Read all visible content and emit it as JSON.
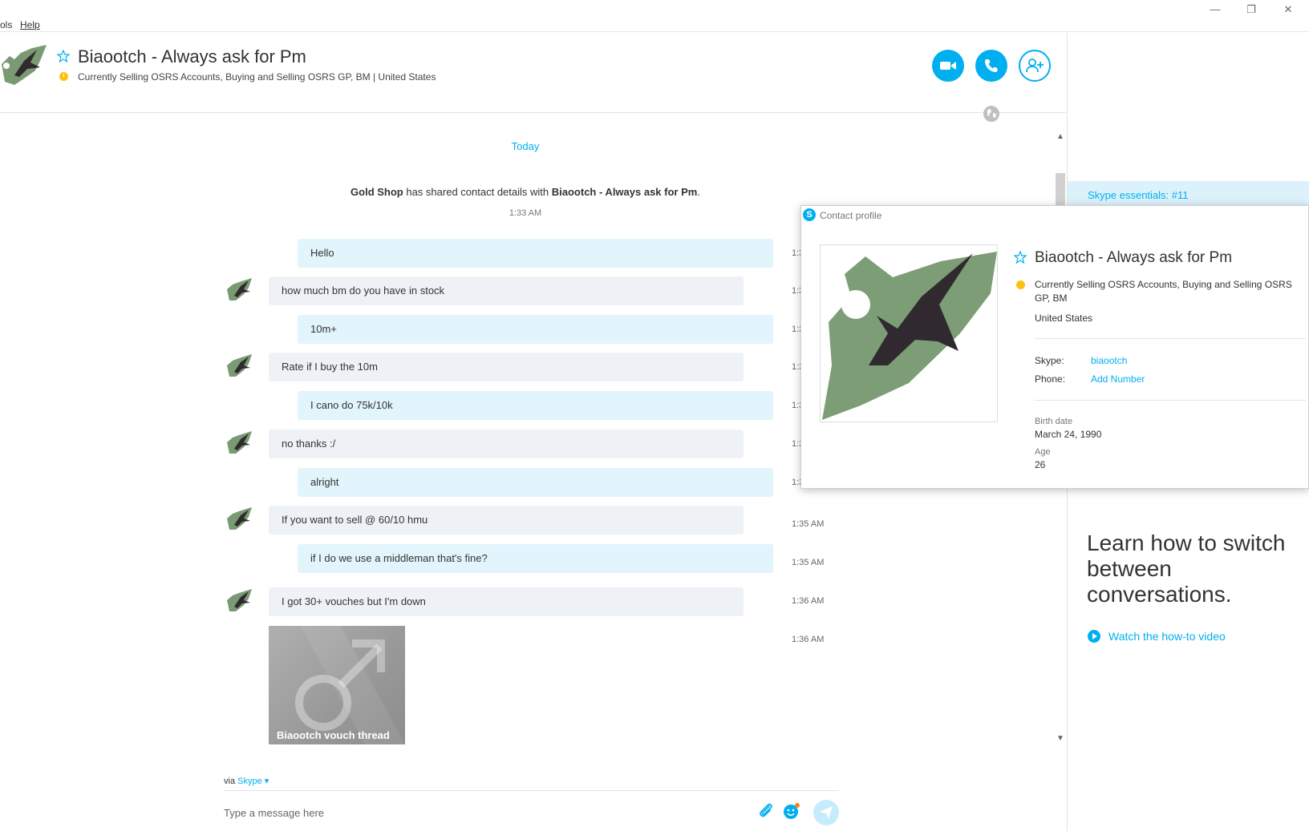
{
  "menu": {
    "tools": "ols",
    "help": "Help"
  },
  "window": {
    "minimize": "—",
    "restore": "❐",
    "close": "✕"
  },
  "header": {
    "title": "Biaootch - Always ask for Pm",
    "status": "Currently Selling OSRS Accounts, Buying and Selling OSRS GP, BM  |  United States",
    "presence_color": "#fdc10f",
    "accent_color": "#00aff0"
  },
  "chat": {
    "day_separator": "Today",
    "shared_notice": {
      "part1": "Gold Shop",
      "part2": " has shared contact details with ",
      "part3": "Biaootch - Always ask for Pm",
      "part4": ".",
      "time": "1:33 AM"
    },
    "messages": [
      {
        "dir": "out",
        "text": "Hello",
        "time": "1:3"
      },
      {
        "dir": "in",
        "text": "how much bm do you have in stock",
        "time": "1:3"
      },
      {
        "dir": "out",
        "text": "10m+",
        "time": "1:3"
      },
      {
        "dir": "in",
        "text": "Rate if I buy the 10m",
        "time": "1:3"
      },
      {
        "dir": "out",
        "text": "I cano do 75k/10k",
        "time": "1:3"
      },
      {
        "dir": "in",
        "text": "no thanks :/",
        "time": "1:3"
      },
      {
        "dir": "out",
        "text": "alright",
        "time": "1:3"
      },
      {
        "dir": "in",
        "text": "If you want to sell @ 60/10 hmu",
        "time": "1:35 AM"
      },
      {
        "dir": "out",
        "text": "if I do we use a middleman that's fine?",
        "time": "1:35 AM"
      },
      {
        "dir": "in",
        "text": "I got 30+ vouches but I'm down",
        "time": "1:36 AM"
      }
    ],
    "link_preview": {
      "title": "Biaootch vouch thread",
      "time": "1:36 AM"
    }
  },
  "compose": {
    "via_prefix": "via",
    "via_service": "Skype",
    "placeholder": "Type a message here"
  },
  "right_panel": {
    "essentials": "Skype essentials: #11",
    "learn_title": "Learn how to switch between conversations.",
    "watch_link": "Watch the how-to video"
  },
  "profile": {
    "window_title": "Contact profile",
    "name": "Biaootch - Always ask for Pm",
    "status": "Currently Selling OSRS Accounts, Buying and Selling OSRS GP, BM",
    "country": "United States",
    "skype_label": "Skype:",
    "skype_value": "biaootch",
    "phone_label": "Phone:",
    "phone_value": "Add Number",
    "birth_label": "Birth date",
    "birth_value": "March 24, 1990",
    "age_label": "Age",
    "age_value": "26"
  }
}
